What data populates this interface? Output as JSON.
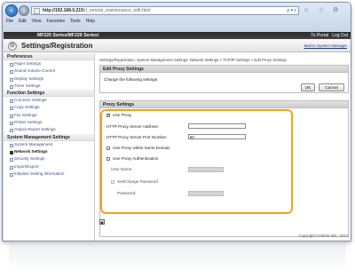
{
  "browser": {
    "back_icon": "back-arrow-icon",
    "url_host": "http://192.168.0.215",
    "url_path": "/rl_remote_maintenance_edit.html",
    "address_tools": "ρ ▾ c",
    "tab_title": "MF220 Series/MF220 Series/",
    "menu": [
      "File",
      "Edit",
      "View",
      "Favorites",
      "Tools",
      "Help"
    ]
  },
  "topstrip": {
    "model": "MF220 Series/MF220 Series/",
    "portal_label": "To Portal",
    "logout_label": "Log Out"
  },
  "header": {
    "title": "Settings/Registration",
    "mail_link": "Mail to System Manager"
  },
  "sidebar": {
    "sections": [
      {
        "label": "Preferences",
        "items": [
          "Paper Settings",
          "Sound Volume Control",
          "Display Settings",
          "Timer Settings"
        ]
      },
      {
        "label": "Function Settings",
        "items": [
          "Common Settings",
          "Copy Settings",
          "Fax Settings",
          "Printer Settings",
          "Output Report Settings"
        ]
      },
      {
        "label": "System Management Settings",
        "items": [
          "System Management",
          "Network Settings",
          "Security Settings",
          "Import/Export",
          "Initialize Setting Information"
        ]
      }
    ],
    "active_item": "Network Settings"
  },
  "main": {
    "breadcrumb": "Settings/Registration: System Management Settings: Network Settings > TCP/IP Settings > Edit Proxy Settings",
    "edit_panel": {
      "title": "Edit Proxy Settings",
      "description": "Change the following settings.",
      "ok_label": "OK",
      "cancel_label": "Cancel"
    },
    "proxy_panel": {
      "title": "Proxy Settings",
      "use_proxy_label": "Use Proxy",
      "use_proxy_checked": true,
      "server_address_label": "HTTP Proxy Server Address:",
      "server_address_value": "",
      "port_label": "HTTP Proxy Server Port Number:",
      "port_value": "80",
      "same_domain_label": "Use Proxy within Same Domain",
      "same_domain_checked": false,
      "auth_label": "Use Proxy Authentication",
      "auth_checked": false,
      "user_name_label": "User Name:",
      "set_password_label": "Set/Change Password",
      "password_label": "Password:"
    },
    "copyright": "Copyright CANON INC. 2014"
  },
  "colors": {
    "highlight": "#f2a21c",
    "link": "#3a4f86",
    "topstrip": "#2a2a2a"
  }
}
